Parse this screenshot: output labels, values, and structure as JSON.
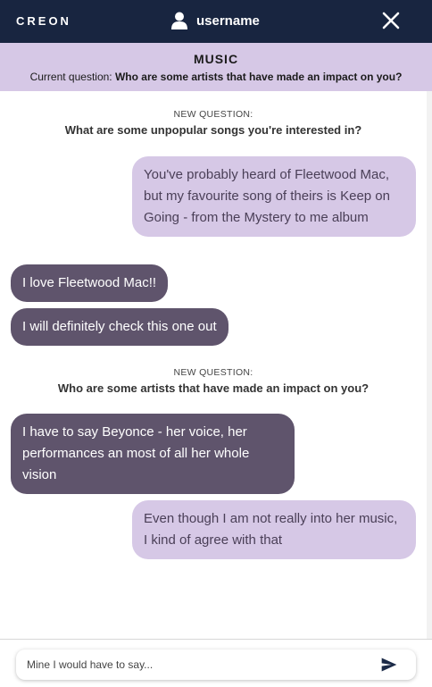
{
  "header": {
    "brand": "CREON",
    "username": "username",
    "icons": {
      "user": "user-icon",
      "close": "close-icon"
    }
  },
  "topic": {
    "title": "MUSIC",
    "current_label": "Current question:",
    "current_question": "Who are some artists that have made an impact on you?"
  },
  "chat": {
    "separators": [
      {
        "kicker": "NEW QUESTION:",
        "question": "What are some unpopular songs you're interested in?"
      },
      {
        "kicker": "NEW QUESTION:",
        "question": "Who are some artists that have made an impact on you?"
      }
    ],
    "messages": [
      {
        "sender": "me",
        "text": "You've probably heard of Fleetwood Mac, but my favourite song of theirs is Keep on Going - from the Mystery to me album"
      },
      {
        "sender": "them",
        "text": "I love Fleetwood Mac!!"
      },
      {
        "sender": "them",
        "text": "I will definitely check this one out"
      },
      {
        "sender": "them",
        "text": "I have to say Beyonce - her voice, her performances an most of all her whole vision"
      },
      {
        "sender": "me",
        "text": "Even though I am not really into her music, I kind of agree with that"
      }
    ]
  },
  "composer": {
    "placeholder": "Mine I would have to say...",
    "send_icon": "send-icon"
  },
  "colors": {
    "header_bg": "#182540",
    "topic_bg": "#d6c8e6",
    "my_bubble": "#d6c8e6",
    "their_bubble": "#5f546c"
  }
}
